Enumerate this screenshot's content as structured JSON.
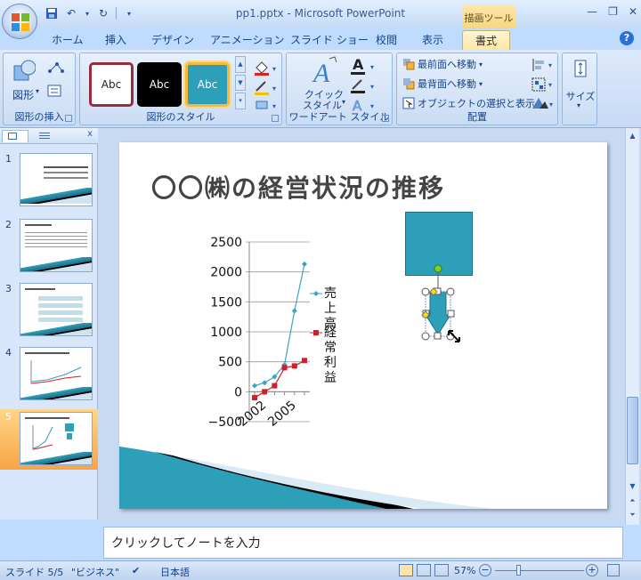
{
  "window": {
    "title": "pp1.pptx - Microsoft PowerPoint",
    "context_tab_group": "描画ツール"
  },
  "tabs": [
    "ホーム",
    "挿入",
    "デザイン",
    "アニメーション",
    "スライド ショー",
    "校閲",
    "表示",
    "書式"
  ],
  "ribbon": {
    "groups": {
      "insert_shapes": {
        "label": "図形の挿入",
        "shapes_button": "図形"
      },
      "shape_styles": {
        "label": "図形のスタイル",
        "swatch_text": "Abc"
      },
      "wordart": {
        "label": "ワードアート スタイル",
        "quick_style_l1": "クイック",
        "quick_style_l2": "スタイル"
      },
      "arrange": {
        "label": "配置",
        "bring_front": "最前面へ移動",
        "send_back": "最背面へ移動",
        "selection": "オブジェクトの選択と表示"
      },
      "size": {
        "label": "サイズ"
      }
    }
  },
  "slides_panel": {
    "numbers": [
      "1",
      "2",
      "3",
      "4",
      "5"
    ],
    "selected": 5
  },
  "slide": {
    "title": "〇〇㈱の経営状況の推移",
    "legend": {
      "sales_l1": "売上",
      "sales_l2": "高",
      "profit_l1": "経常",
      "profit_l2": "利益"
    }
  },
  "chart_data": {
    "type": "line",
    "title": "",
    "x": [
      "2002",
      "2003",
      "2004",
      "2005",
      "2006",
      "2007"
    ],
    "x_tick_labels": [
      "2002",
      "2005"
    ],
    "ylim": [
      -500,
      2500
    ],
    "y_ticks": [
      "2500",
      "2000",
      "1500",
      "1000",
      "500",
      "0",
      "−500"
    ],
    "series": [
      {
        "name": "売上高",
        "color": "#3aa3c5",
        "values": [
          100,
          150,
          250,
          450,
          1350,
          2130
        ]
      },
      {
        "name": "経常利益",
        "color": "#d41e2a",
        "values": [
          -100,
          0,
          100,
          400,
          430,
          520
        ]
      }
    ]
  },
  "notes": {
    "placeholder": "クリックしてノートを入力"
  },
  "status": {
    "slide": "スライド 5/5",
    "theme": "\"ビジネス\"",
    "language": "日本語",
    "zoom": "57%"
  },
  "colors": {
    "accent": "#2e9fb8",
    "ribbon": "#c6daf4"
  }
}
